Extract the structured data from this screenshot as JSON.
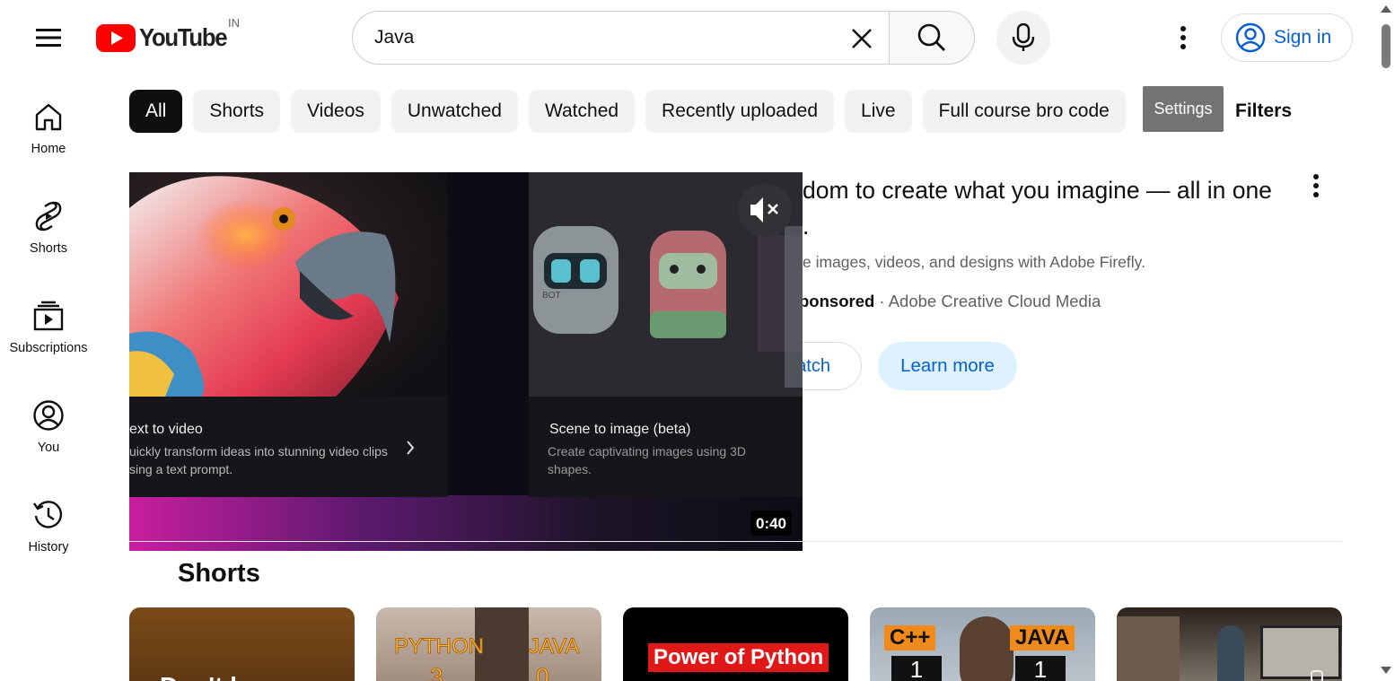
{
  "header": {
    "logo_text": "YouTube",
    "region_code": "IN",
    "search_value": "Java",
    "signin_label": "Sign in",
    "brand_color": "#ff0000",
    "link_color": "#065fd4"
  },
  "sidebar": {
    "items": [
      {
        "label": "Home",
        "icon": "home-icon"
      },
      {
        "label": "Shorts",
        "icon": "shorts-icon"
      },
      {
        "label": "Subscriptions",
        "icon": "subscriptions-icon"
      },
      {
        "label": "You",
        "icon": "account-icon"
      },
      {
        "label": "History",
        "icon": "history-icon"
      }
    ]
  },
  "chips": [
    "All",
    "Shorts",
    "Videos",
    "Unwatched",
    "Watched",
    "Recently uploaded",
    "Live",
    "Full course bro code"
  ],
  "filter_bar": {
    "settings_label": "Settings",
    "filters_label": "Filters"
  },
  "ad": {
    "title_line1": "dom to create what you imagine — all in one",
    "title_line2": ".",
    "description": "e images, videos, and designs with Adobe Firefly.",
    "sponsored_label": "ponsored",
    "separator": "·",
    "advertiser": "Adobe Creative Cloud Media",
    "watch_label": "atch",
    "learn_more_label": "Learn more",
    "video": {
      "duration": "0:40",
      "card1_title": "ext to video",
      "card1_desc_line1": "uickly transform ideas into stunning video clips",
      "card1_desc_line2": "sing a text prompt.",
      "card2_title": "Scene to image (beta)",
      "card2_desc_line1": "Create captivating images using 3D",
      "card2_desc_line2": "shapes.",
      "robot_tag": "BOT"
    }
  },
  "shorts": {
    "section_title": "Shorts",
    "items": [
      {
        "thumb_text": "Don't l"
      },
      {
        "left_label": "PYTHON",
        "right_label": "JAVA",
        "left_num": "3",
        "right_num": "0"
      },
      {
        "banner": "Power of Python"
      },
      {
        "left_label": "C++",
        "right_label": "JAVA",
        "left_num": "1",
        "right_num": "1"
      },
      {
        "thumb_text": ""
      }
    ]
  }
}
